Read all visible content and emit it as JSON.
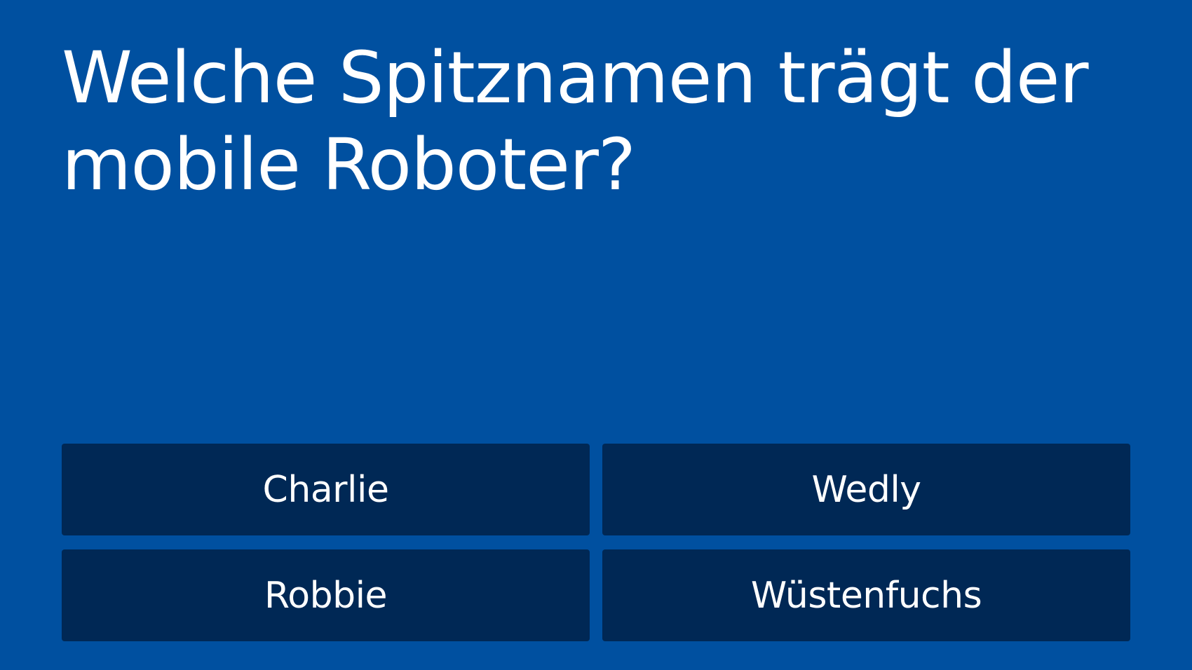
{
  "quiz": {
    "question": "Welche Spitznamen trägt der mobile Roboter?",
    "answers": [
      {
        "label": "Charlie"
      },
      {
        "label": "Wedly"
      },
      {
        "label": "Robbie"
      },
      {
        "label": "Wüstenfuchs"
      }
    ]
  },
  "colors": {
    "background": "#0050a0",
    "answer_button": "#002855",
    "text": "#ffffff"
  }
}
